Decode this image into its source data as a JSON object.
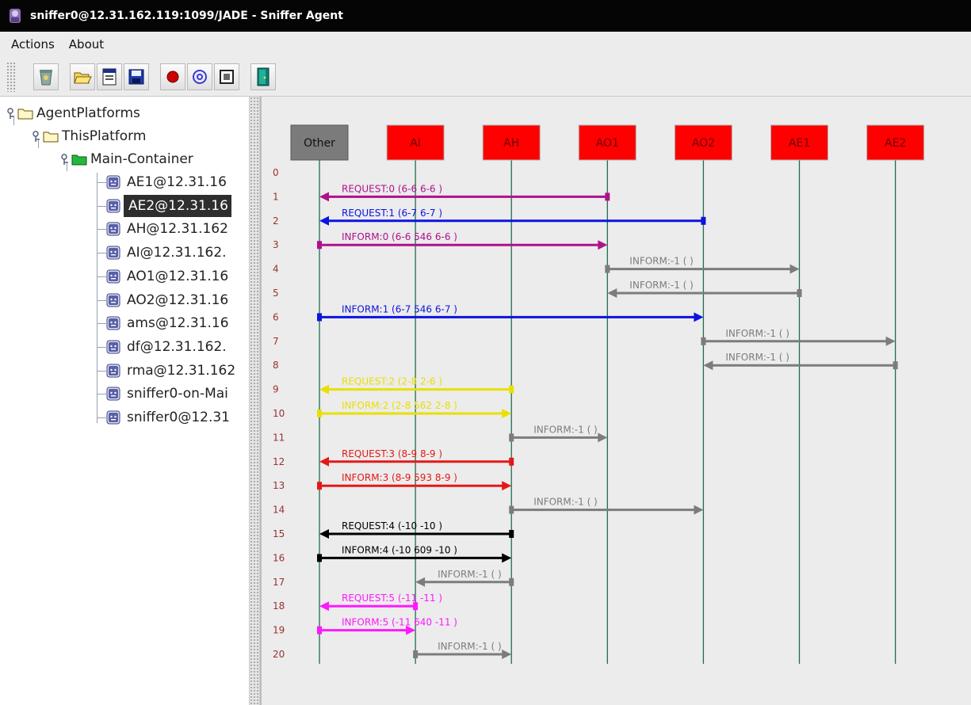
{
  "window": {
    "title": "sniffer0@12.31.162.119:1099/JADE - Sniffer Agent"
  },
  "menu": {
    "items": [
      "Actions",
      "About"
    ]
  },
  "toolbar": {
    "buttons": [
      {
        "name": "trash-button",
        "icon": "trash-icon"
      },
      {
        "name": "open-button",
        "icon": "open-folder-icon"
      },
      {
        "name": "properties-button",
        "icon": "properties-icon"
      },
      {
        "name": "save-button",
        "icon": "save-icon"
      },
      {
        "name": "record-button",
        "icon": "record-icon"
      },
      {
        "name": "sniff-button",
        "icon": "sniff-icon"
      },
      {
        "name": "filter-button",
        "icon": "filter-icon"
      },
      {
        "name": "exit-button",
        "icon": "exit-door-icon"
      }
    ]
  },
  "tree": {
    "root": "AgentPlatforms",
    "platform": "ThisPlatform",
    "container": "Main-Container",
    "agents": [
      "AE1@12.31.16",
      "AE2@12.31.16",
      "AH@12.31.162",
      "AI@12.31.162.",
      "AO1@12.31.16",
      "AO2@12.31.16",
      "ams@12.31.16",
      "df@12.31.162.",
      "rma@12.31.162",
      "sniffer0-on-Mai",
      "sniffer0@12.31"
    ],
    "selected_index": 1
  },
  "diagram": {
    "agents": [
      "Other",
      "AI",
      "AH",
      "AO1",
      "AO2",
      "AE1",
      "AE2"
    ],
    "colors": {
      "other_box": "#7b7b7b",
      "agent_box": "#ff0000",
      "lifeline": "#1e6e4a",
      "purple": "#b0108c",
      "blue": "#0b14e0",
      "gray": "#7c7c7c",
      "yellow": "#e8e000",
      "red": "#e41818",
      "black": "#000000",
      "magenta": "#ff18ff"
    },
    "rows": [
      "0",
      "1",
      "2",
      "3",
      "4",
      "5",
      "6",
      "7",
      "8",
      "9",
      "10",
      "11",
      "12",
      "13",
      "14",
      "15",
      "16",
      "17",
      "18",
      "19",
      "20"
    ],
    "messages": [
      {
        "row": 1,
        "from": "AO1",
        "to": "Other",
        "label": "REQUEST:0 (6-6  6-6    )",
        "color": "purple"
      },
      {
        "row": 2,
        "from": "AO2",
        "to": "Other",
        "label": "REQUEST:1 (6-7  6-7    )",
        "color": "blue"
      },
      {
        "row": 3,
        "from": "Other",
        "to": "AO1",
        "label": "INFORM:0 (6-6  546  6-6 )",
        "color": "purple"
      },
      {
        "row": 4,
        "from": "AO1",
        "to": "AE1",
        "label": "INFORM:-1 (       )",
        "color": "gray"
      },
      {
        "row": 5,
        "from": "AE1",
        "to": "AO1",
        "label": "INFORM:-1 (       )",
        "color": "gray"
      },
      {
        "row": 6,
        "from": "Other",
        "to": "AO2",
        "label": "INFORM:1 (6-7  546  6-7 )",
        "color": "blue"
      },
      {
        "row": 7,
        "from": "AO2",
        "to": "AE2",
        "label": "INFORM:-1 (       )",
        "color": "gray"
      },
      {
        "row": 8,
        "from": "AE2",
        "to": "AO2",
        "label": "INFORM:-1 (       )",
        "color": "gray"
      },
      {
        "row": 9,
        "from": "AH",
        "to": "Other",
        "label": "REQUEST:2 (2-8  2-6    )",
        "color": "yellow"
      },
      {
        "row": 10,
        "from": "Other",
        "to": "AH",
        "label": "INFORM:2 (2-8  562  2-8 )",
        "color": "yellow"
      },
      {
        "row": 11,
        "from": "AH",
        "to": "AO1",
        "label": "INFORM:-1 (       )",
        "color": "gray"
      },
      {
        "row": 12,
        "from": "AH",
        "to": "Other",
        "label": "REQUEST:3 (8-9  8-9    )",
        "color": "red"
      },
      {
        "row": 13,
        "from": "Other",
        "to": "AH",
        "label": "INFORM:3 (8-9  593  8-9 )",
        "color": "red"
      },
      {
        "row": 14,
        "from": "AH",
        "to": "AO2",
        "label": "INFORM:-1 (       )",
        "color": "gray"
      },
      {
        "row": 15,
        "from": "AH",
        "to": "Other",
        "label": "REQUEST:4 (-10  -10    )",
        "color": "black"
      },
      {
        "row": 16,
        "from": "Other",
        "to": "AH",
        "label": "INFORM:4 (-10  609  -10 )",
        "color": "black"
      },
      {
        "row": 17,
        "from": "AH",
        "to": "AI",
        "label": "INFORM:-1 (       )",
        "color": "gray"
      },
      {
        "row": 18,
        "from": "AI",
        "to": "Other",
        "label": "REQUEST:5 (-11  -11    )",
        "color": "magenta"
      },
      {
        "row": 19,
        "from": "Other",
        "to": "AI",
        "label": "INFORM:5 (-11  640  -11 )",
        "color": "magenta"
      },
      {
        "row": 20,
        "from": "AI",
        "to": "AH",
        "label": "INFORM:-1 (       )",
        "color": "gray"
      }
    ]
  }
}
